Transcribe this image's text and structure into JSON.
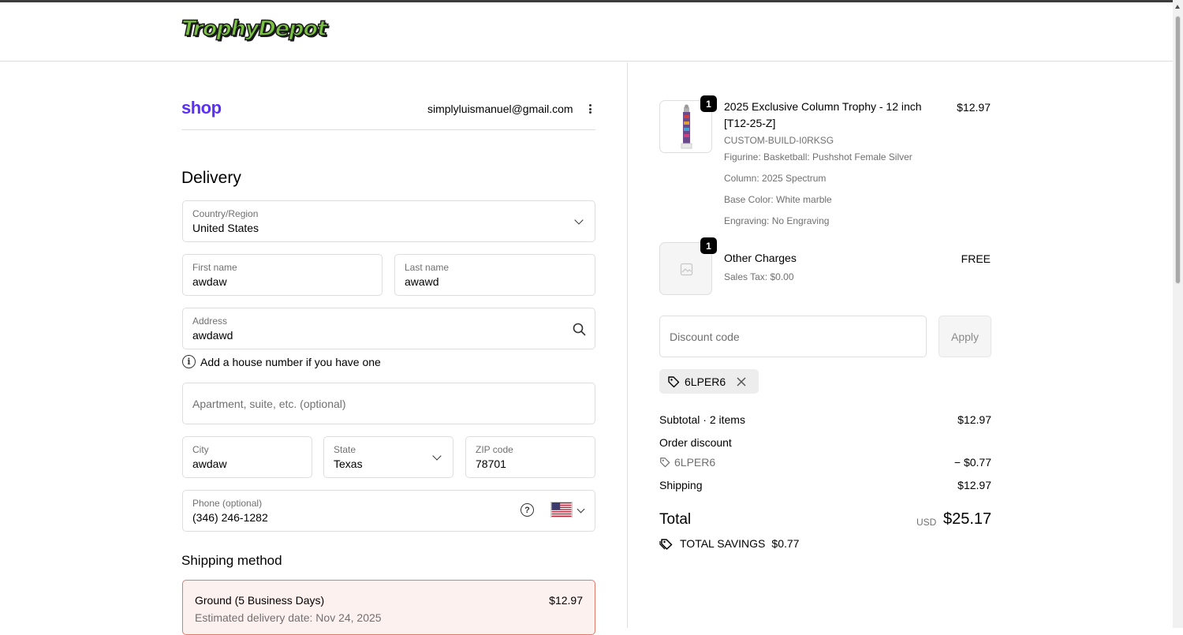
{
  "header": {
    "logo_text": "TrophyDepot"
  },
  "account": {
    "shop_logo": "shop",
    "email": "simplyluismanuel@gmail.com"
  },
  "delivery": {
    "title": "Delivery",
    "country": {
      "label": "Country/Region",
      "value": "United States"
    },
    "first_name": {
      "label": "First name",
      "value": "awdaw"
    },
    "last_name": {
      "label": "Last name",
      "value": "awawd"
    },
    "address": {
      "label": "Address",
      "value": "awdawd"
    },
    "address_hint": "Add a house number if you have one",
    "apartment": {
      "placeholder": "Apartment, suite, etc. (optional)"
    },
    "city": {
      "label": "City",
      "value": "awdaw"
    },
    "state": {
      "label": "State",
      "value": "Texas"
    },
    "zip": {
      "label": "ZIP code",
      "value": "78701"
    },
    "phone": {
      "label": "Phone (optional)",
      "value": "(346) 246-1282"
    }
  },
  "shipping": {
    "title": "Shipping method",
    "option_name": "Ground (5 Business Days)",
    "option_price": "$12.97",
    "option_eta": "Estimated delivery date: Nov 24, 2025"
  },
  "summary": {
    "items": [
      {
        "qty": "1",
        "title": "2025 Exclusive Column Trophy - 12 inch [T12-25-Z]",
        "sku": "CUSTOM-BUILD-I0RKSG",
        "options": [
          "Figurine: Basketball: Pushshot Female Silver",
          "Column: 2025 Spectrum",
          "Base Color: White marble",
          "Engraving: No Engraving"
        ],
        "price": "$12.97"
      },
      {
        "qty": "1",
        "title": "Other Charges",
        "meta": "Sales Tax: $0.00",
        "price": "FREE"
      }
    ],
    "discount_placeholder": "Discount code",
    "apply_label": "Apply",
    "applied_code": "6LPER6",
    "subtotal_label": "Subtotal · 2 items",
    "subtotal_value": "$12.97",
    "order_discount_label": "Order discount",
    "discount_code": "6LPER6",
    "discount_value": "− $0.77",
    "shipping_label": "Shipping",
    "shipping_value": "$12.97",
    "total_label": "Total",
    "currency": "USD",
    "total_value": "$25.17",
    "savings_label": "TOTAL SAVINGS",
    "savings_value": "$0.77"
  },
  "colors": {
    "shop_purple": "#5a31f4",
    "logo_green": "#7ac143",
    "selected_ship_border": "#e07a6b",
    "selected_ship_bg": "#fdf1f0"
  }
}
